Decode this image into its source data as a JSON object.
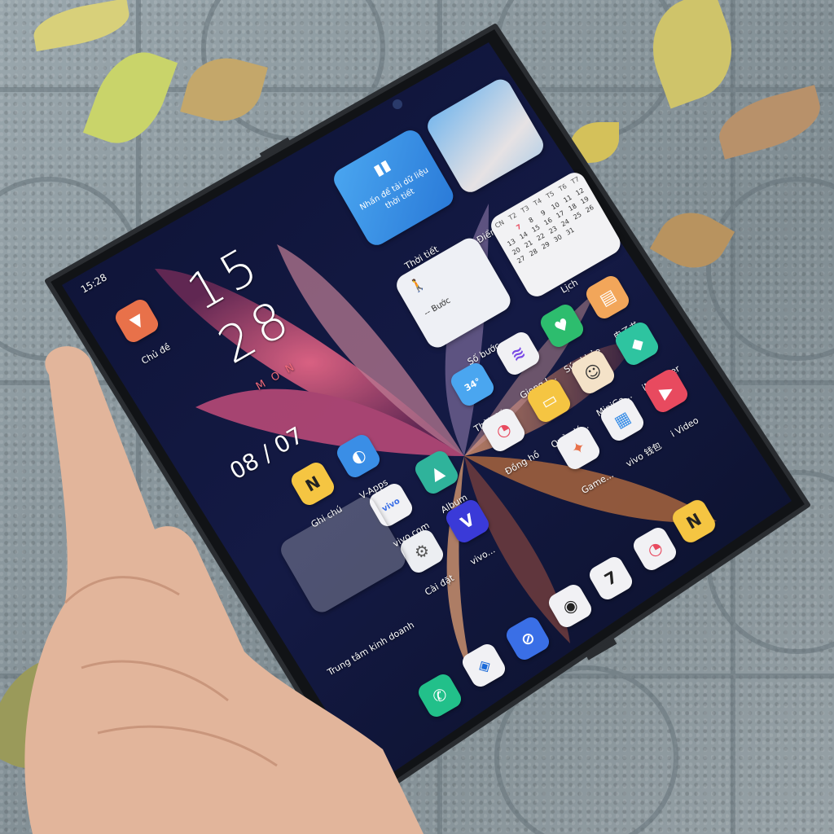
{
  "status_bar": {
    "time": "15:28"
  },
  "clock": {
    "hour": "15",
    "minute": "28",
    "weekday": "M O N",
    "date": "08 / 07"
  },
  "widgets": {
    "weather": {
      "text": "Nhấn để tải dữ liệu thời tiết",
      "label": "Thời tiết"
    },
    "gallery": {
      "label": "Điểm nổi bật của alb..."
    },
    "steps": {
      "text": "-- Bước",
      "label": "Số bước"
    },
    "calendar": {
      "label": "Lịch",
      "weekdays": [
        "CN",
        "T2",
        "T3",
        "T4",
        "T5",
        "T6",
        "T7"
      ],
      "rows": [
        [
          "",
          "",
          "",
          "",
          "",
          "",
          ""
        ],
        [
          "",
          "7",
          "8",
          "9",
          "10",
          "11",
          "12"
        ],
        [
          "13",
          "14",
          "15",
          "16",
          "17",
          "18",
          "19"
        ],
        [
          "20",
          "21",
          "22",
          "23",
          "24",
          "25",
          "26"
        ],
        [
          "27",
          "28",
          "29",
          "30",
          "31",
          "",
          ""
        ]
      ],
      "highlight": "7"
    }
  },
  "apps": {
    "chu_de": "Chủ đề",
    "ghi_chu": "Ghi chú",
    "v_apps": "V-Apps",
    "vivo_com": "vivo.com",
    "album": "Album",
    "vivo_browser": "vivo...",
    "cai_dat": "Cài đặt",
    "folder": "Trung tâm kinh doanh",
    "thoi_tiet": "Thời tiết",
    "giong": "Giọng J...",
    "suc_khoe": "Sức khỏe",
    "dien_tu": "电子书",
    "imanager": "iManager",
    "mini": "MiniGa...",
    "ivideo": "i Video",
    "quan_ly": "Quản lý...",
    "dong_ho": "Đồng hồ",
    "game": "Game...",
    "vivo_wallet": "vivo 钱包",
    "weather_temp": "34°"
  },
  "colors": {
    "chu_de": "#e8714a",
    "ghi_chu": "#f5c542",
    "v_apps": "#3a8ee6",
    "album": "#2fb39b",
    "suc_khoe": "#2dbd6e",
    "imanager": "#2ec4a0",
    "ivideo": "#e84a5f",
    "phone": "#22c08a",
    "browser": "#3a6fe6"
  }
}
